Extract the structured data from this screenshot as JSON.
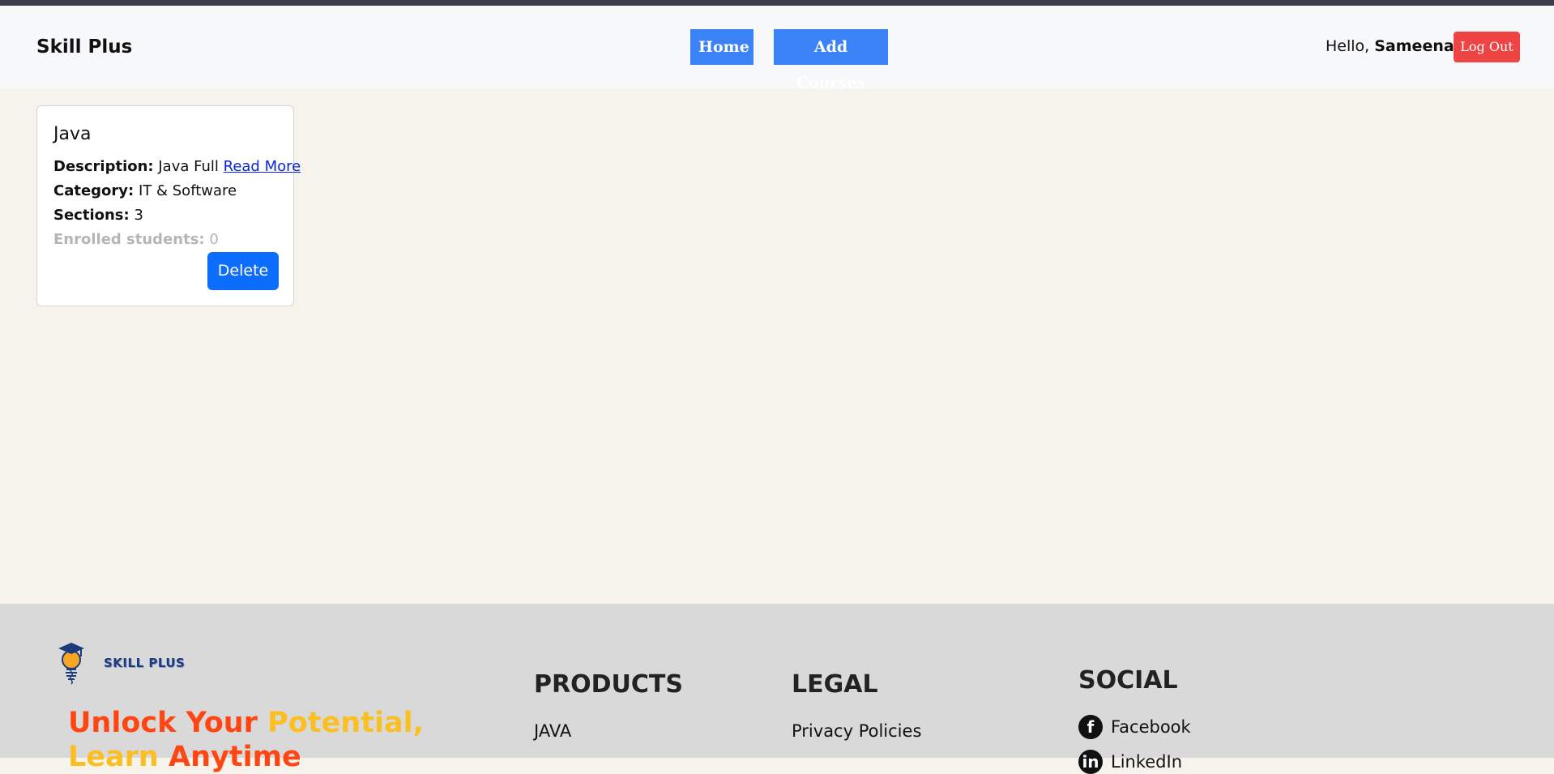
{
  "header": {
    "brand": "Skill Plus",
    "nav": {
      "home": "Home",
      "add_courses": "Add Courses"
    },
    "greeting": "Hello,",
    "username": "Sameena",
    "logout": "Log Out"
  },
  "course": {
    "title": "Java",
    "description_label": "Description:",
    "description_value": "Java Full",
    "read_more": "Read More",
    "category_label": "Category:",
    "category_value": "IT & Software",
    "sections_label": "Sections:",
    "sections_value": "3",
    "enrolled_label": "Enrolled students:",
    "enrolled_value": "0",
    "delete": "Delete"
  },
  "footer": {
    "logo_text": "SKILL PLUS",
    "slogan": {
      "part1": "Unlock Your",
      "part2": "Potential,",
      "part3": "Learn",
      "part4": "Anytime"
    },
    "products": {
      "title": "PRODUCTS",
      "links": [
        "JAVA"
      ]
    },
    "legal": {
      "title": "LEGAL",
      "links": [
        "Privacy Policies"
      ]
    },
    "social": {
      "title": "SOCIAL",
      "links": [
        "Facebook",
        "LinkedIn"
      ]
    }
  },
  "colors": {
    "nav_button": "#3b82f6",
    "logout": "#ef4444",
    "delete": "#0d6efd",
    "slogan_red": "#ff4512",
    "slogan_yellow": "#fbbf24"
  }
}
